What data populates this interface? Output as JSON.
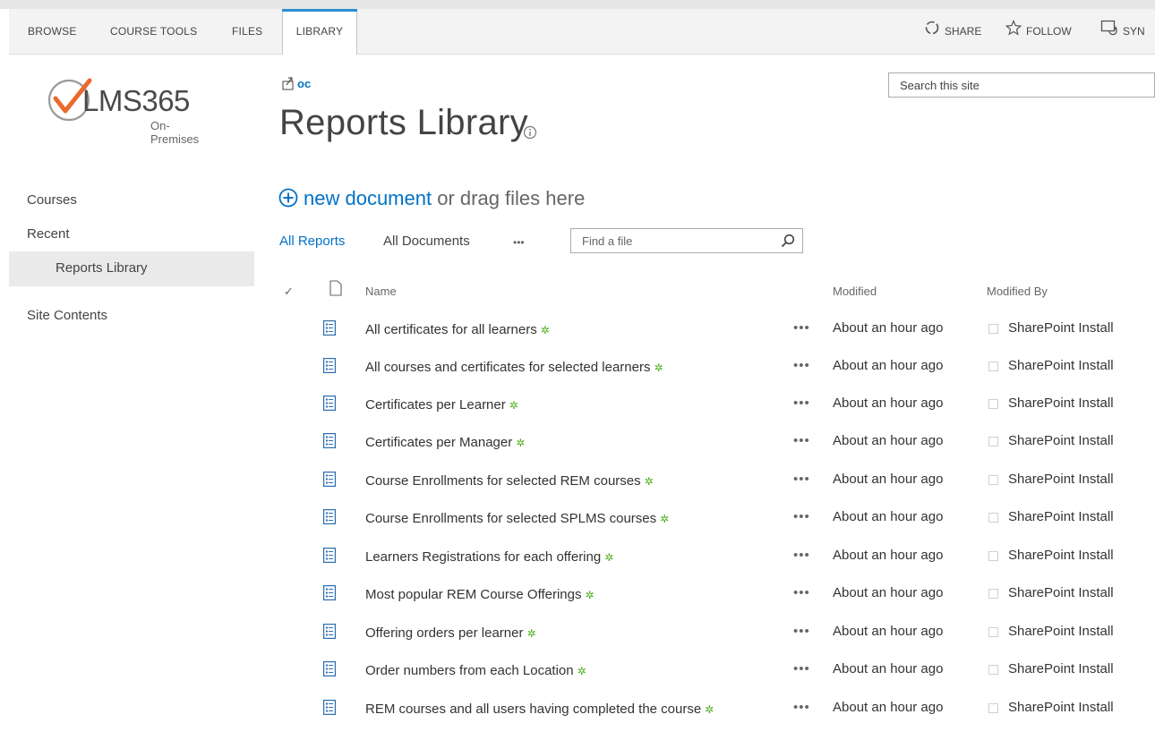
{
  "ribbon": {
    "tabs": [
      "BROWSE",
      "COURSE TOOLS",
      "FILES",
      "LIBRARY"
    ],
    "active_tab": "LIBRARY",
    "share_label": "SHARE",
    "follow_label": "FOLLOW",
    "sync_label": "SYN"
  },
  "logo": {
    "brand": "LMS365",
    "sub": "On-Premises",
    "accent": "#e86a2d"
  },
  "nav": {
    "items": [
      "Courses",
      "Recent",
      "Reports Library",
      "Site Contents"
    ],
    "selected": "Reports Library"
  },
  "breadcrumb": {
    "label": "oc"
  },
  "page": {
    "title": "Reports Library"
  },
  "search": {
    "placeholder": "Search this site"
  },
  "new_document": {
    "link": "new document",
    "rest": "or drag files here"
  },
  "views": {
    "items": [
      "All Reports",
      "All Documents",
      "•••"
    ],
    "active": "All Reports"
  },
  "find": {
    "placeholder": "Find a file"
  },
  "table": {
    "headers": {
      "check": "✓",
      "name": "Name",
      "modified": "Modified",
      "modified_by": "Modified By"
    },
    "rows": [
      {
        "name": "All certificates for all learners",
        "modified": "About an hour ago",
        "modified_by": "SharePoint Install"
      },
      {
        "name": "All courses and certificates for selected learners",
        "modified": "About an hour ago",
        "modified_by": "SharePoint Install"
      },
      {
        "name": "Certificates per Learner",
        "modified": "About an hour ago",
        "modified_by": "SharePoint Install"
      },
      {
        "name": "Certificates per Manager",
        "modified": "About an hour ago",
        "modified_by": "SharePoint Install"
      },
      {
        "name": "Course Enrollments for selected REM courses",
        "modified": "About an hour ago",
        "modified_by": "SharePoint Install"
      },
      {
        "name": "Course Enrollments for selected SPLMS courses",
        "modified": "About an hour ago",
        "modified_by": "SharePoint Install"
      },
      {
        "name": "Learners Registrations for each offering",
        "modified": "About an hour ago",
        "modified_by": "SharePoint Install"
      },
      {
        "name": "Most popular REM Course Offerings",
        "modified": "About an hour ago",
        "modified_by": "SharePoint Install"
      },
      {
        "name": "Offering orders per learner",
        "modified": "About an hour ago",
        "modified_by": "SharePoint Install"
      },
      {
        "name": "Order numbers from each Location",
        "modified": "About an hour ago",
        "modified_by": "SharePoint Install"
      },
      {
        "name": "REM courses and all users having completed the course",
        "modified": "About an hour ago",
        "modified_by": "SharePoint Install"
      }
    ],
    "new_badge": "✲",
    "row_menu": "•••"
  },
  "colors": {
    "accent": "#0072c6",
    "ribbon_active": "#2a8dd4",
    "new_badge": "#4caf1a"
  }
}
